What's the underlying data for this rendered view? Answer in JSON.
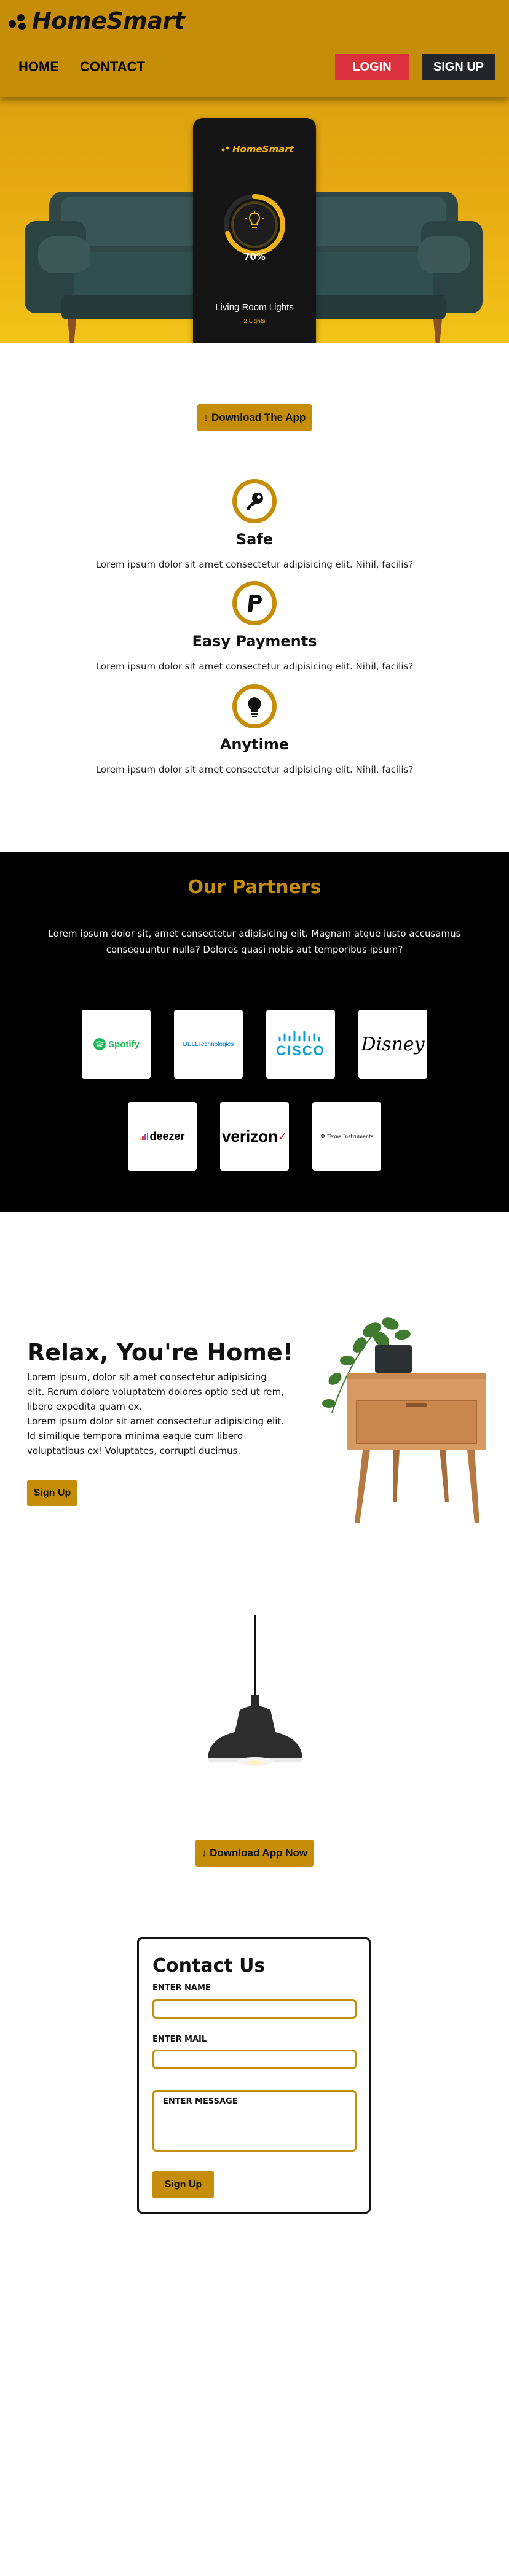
{
  "header": {
    "logo": "HomeSmart",
    "nav": [
      "HOME",
      "CONTACT"
    ],
    "login_label": "LOGIN",
    "signup_label": "SIGN UP"
  },
  "hero": {
    "phone": {
      "logo": "HomeSmart",
      "brightness": "70%",
      "brightness_value": 0.7,
      "room": "Living Room Lights",
      "count": "2 Lights"
    },
    "download_label": "↓ Download The App"
  },
  "features": [
    {
      "icon": "key-icon",
      "title": "Safe",
      "desc": "Lorem ipsum dolor sit amet consectetur adipisicing elit. Nihil, facilis?"
    },
    {
      "icon": "paypal-icon",
      "title": "Easy Payments",
      "desc": "Lorem ipsum dolor sit amet consectetur adipisicing elit. Nihil, facilis?"
    },
    {
      "icon": "lightbulb-icon",
      "title": "Anytime",
      "desc": "Lorem ipsum dolor sit amet consectetur adipisicing elit. Nihil, facilis?"
    }
  ],
  "partners": {
    "title": "Our Partners",
    "desc": "Lorem ipsum dolor sit, amet consectetur adipisicing elit. Magnam atque iusto accusamus consequuntur nulla? Dolores quasi nobis aut temporibus ipsum?",
    "logos": [
      {
        "name": "Spotify",
        "color": "#1db954"
      },
      {
        "name": "DELLTechnologies",
        "color": "#0076ce"
      },
      {
        "name": "CISCO",
        "color": "#049fd9"
      },
      {
        "name": "Disney",
        "color": "#000000"
      },
      {
        "name": "deezer",
        "color": "#000000"
      },
      {
        "name": "verizon",
        "color": "#000000"
      },
      {
        "name": "Texas Instruments",
        "color": "#000000"
      }
    ]
  },
  "relax": {
    "title": "Relax, You're Home!",
    "p1": "Lorem ipsum, dolor sit amet consectetur adipisicing elit. Rerum dolore voluptatem dolores optio sed ut rem, libero expedita quam ex.",
    "p2": "Lorem ipsum dolor sit amet consectetur adipisicing elit. Id similique tempora minima eaque cum libero voluptatibus ex! Voluptates, corrupti ducimus.",
    "signup_label": "Sign Up"
  },
  "download2_label": "↓ Download App Now",
  "contact": {
    "title": "Contact Us",
    "name_label": "ENTER NAME",
    "mail_label": "ENTER MAIL",
    "message_label": "ENTER MESSAGE",
    "submit_label": "Sign Up"
  },
  "colors": {
    "accent": "#c68d08",
    "login": "#d9303b",
    "signup": "#22262b",
    "partners_bg": "#000000"
  }
}
